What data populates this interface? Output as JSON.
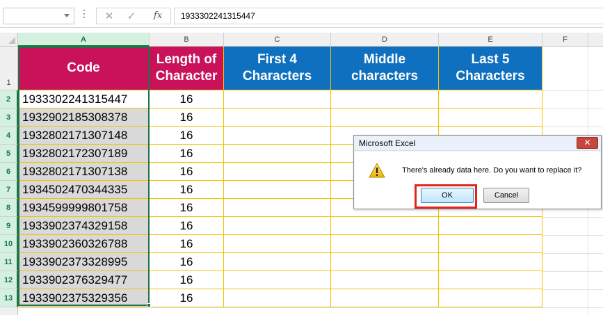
{
  "formula_bar": {
    "name_box": "",
    "cancel_glyph": "✕",
    "enter_glyph": "✓",
    "fx_label": "fx",
    "value": "1933302241315447"
  },
  "columns": [
    "A",
    "B",
    "C",
    "D",
    "E",
    "F"
  ],
  "rows": [
    "1",
    "2",
    "3",
    "4",
    "5",
    "6",
    "7",
    "8",
    "9",
    "10",
    "11",
    "12",
    "13"
  ],
  "headers": {
    "code": "Code",
    "length": [
      "Length of",
      "Character"
    ],
    "first4": [
      "First 4",
      "Characters"
    ],
    "middle": [
      "Middle",
      "characters"
    ],
    "last5": [
      "Last 5",
      "Characters"
    ]
  },
  "table": {
    "codes": [
      "1933302241315447",
      "1932902185308378",
      "1932802171307148",
      "1932802172307189",
      "1932802171307138",
      "1934502470344335",
      "1934599999801758",
      "1933902374329158",
      "1933902360326788",
      "1933902373328995",
      "1933902376329477",
      "1933902375329356"
    ],
    "lengths": [
      "16",
      "16",
      "16",
      "16",
      "16",
      "16",
      "16",
      "16",
      "16",
      "16",
      "16",
      "16"
    ]
  },
  "dialog": {
    "title": "Microsoft Excel",
    "close_glyph": "✕",
    "message": "There's already data here. Do you want to replace it?",
    "ok_label": "OK",
    "cancel_label": "Cancel",
    "icon": "warning-icon"
  },
  "colors": {
    "header_pink": "#c9125a",
    "header_blue": "#0f70c0",
    "cell_border": "#f2c200",
    "selection": "#217346",
    "highlight": "#e1251b"
  }
}
